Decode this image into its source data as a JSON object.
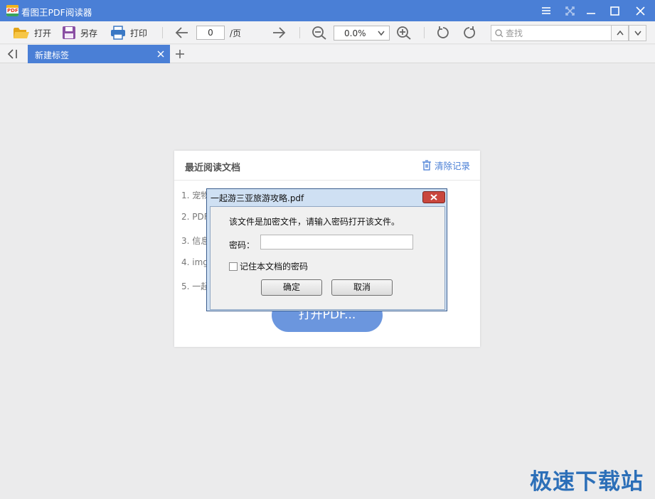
{
  "window": {
    "title": "看图王PDF阅读器",
    "app_icon_text": "PDF"
  },
  "toolbar": {
    "open_label": "打开",
    "save_as_label": "另存",
    "print_label": "打印",
    "page_value": "0",
    "page_suffix": "/页",
    "zoom_value": "0.0%",
    "search_placeholder": "查找"
  },
  "tabs": [
    {
      "label": "新建标签"
    }
  ],
  "recent": {
    "title": "最近阅读文档",
    "clear_label": "清除记录",
    "items": [
      "1. 宠物",
      "2. PDF",
      "3. 信息",
      "4. img",
      "5. 一起"
    ],
    "open_button_label": "打开PDF..."
  },
  "dialog": {
    "title": "一起游三亚旅游攻略.pdf",
    "message": "该文件是加密文件，请输入密码打开该文件。",
    "password_label": "密码：",
    "password_value": "",
    "remember_label": "记住本文档的密码",
    "remember_checked": false,
    "ok_label": "确定",
    "cancel_label": "取消"
  },
  "watermark": "极速下载站",
  "colors": {
    "accent": "#4a7fd6",
    "open_button": "#6b96de",
    "dialog_frame": "#cfe0f3",
    "dialog_close": "#c9463d",
    "watermark": "#2c6fb8"
  }
}
